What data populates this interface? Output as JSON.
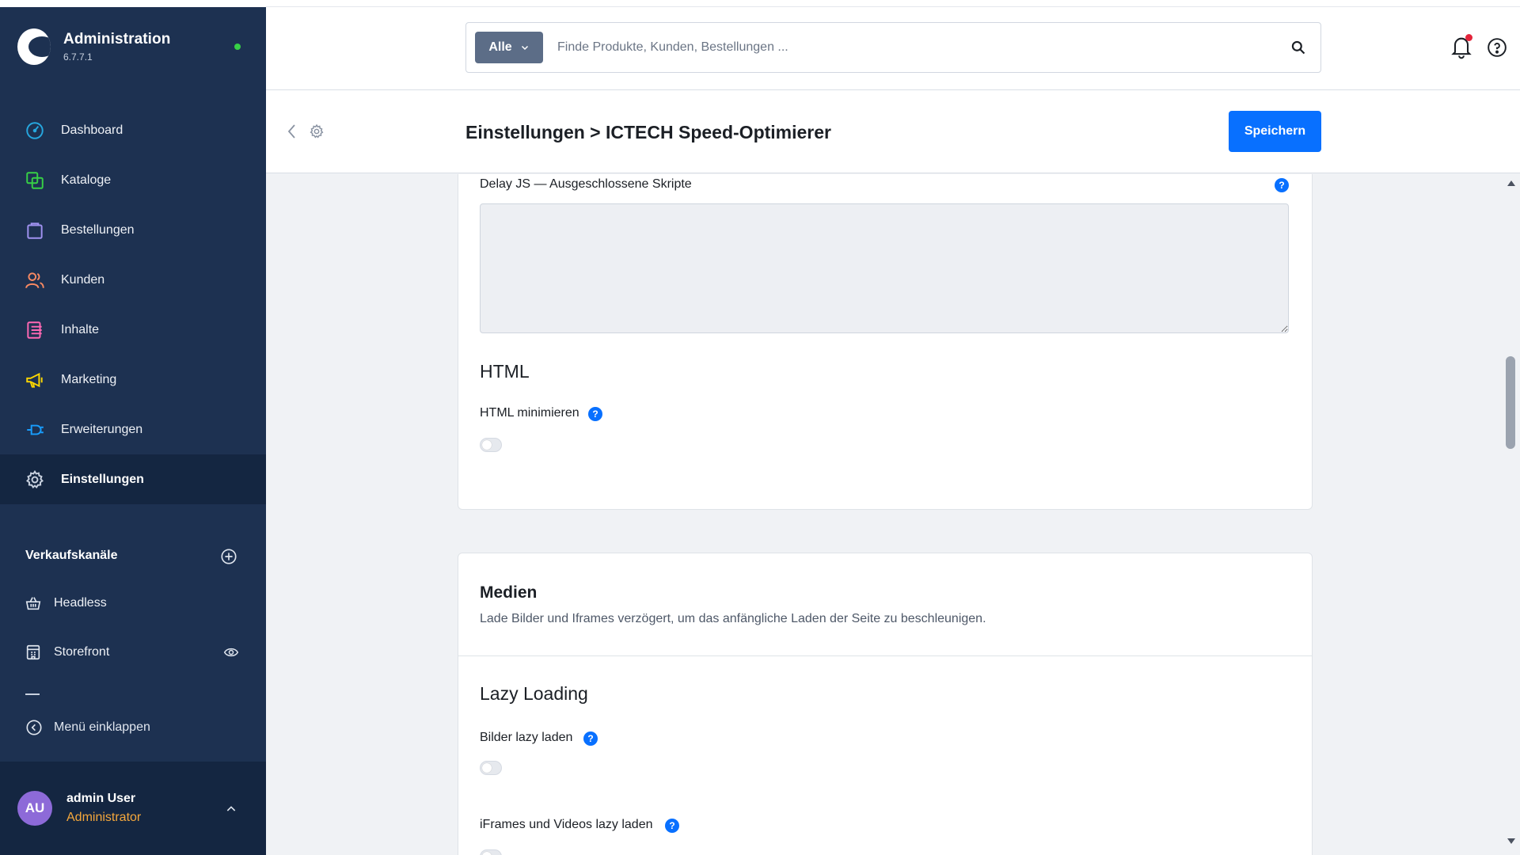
{
  "sidebar": {
    "brand_title": "Administration",
    "brand_version": "6.7.7.1",
    "nav": [
      {
        "label": "Dashboard",
        "icon": "dashboard-gauge-icon",
        "color": "#26a7df"
      },
      {
        "label": "Kataloge",
        "icon": "catalog-icon",
        "color": "#37d046"
      },
      {
        "label": "Bestellungen",
        "icon": "orders-bag-icon",
        "color": "#a092f0"
      },
      {
        "label": "Kunden",
        "icon": "customers-icon",
        "color": "#f88962"
      },
      {
        "label": "Inhalte",
        "icon": "content-icon",
        "color": "#ff68b4"
      },
      {
        "label": "Marketing",
        "icon": "megaphone-icon",
        "color": "#ffd700"
      },
      {
        "label": "Erweiterungen",
        "icon": "plug-icon",
        "color": "#189eff"
      },
      {
        "label": "Einstellungen",
        "icon": "gear-icon",
        "color": "#c8d1df"
      }
    ],
    "sales_channels_title": "Verkaufskanäle",
    "sales_channels": [
      {
        "label": "Headless",
        "icon": "basket-icon"
      },
      {
        "label": "Storefront",
        "icon": "storefront-icon"
      }
    ],
    "collapse_label": "Menü einklappen",
    "user": {
      "initials": "AU",
      "name": "admin User",
      "role": "Administrator"
    }
  },
  "topbar": {
    "search_type": "Alle",
    "search_placeholder": "Finde Produkte, Kunden, Bestellungen ..."
  },
  "smartbar": {
    "title": "Einstellungen > ICTECH Speed-Optimierer",
    "save_label": "Speichern"
  },
  "content": {
    "delay_js_label": "Delay JS — Ausgeschlossene Skripte",
    "html_section_title": "HTML",
    "html_minify_label": "HTML minimieren",
    "media_title": "Medien",
    "media_subtitle": "Lade Bilder und Iframes verzögert, um das anfängliche Laden der Seite zu beschleunigen.",
    "lazy_section_title": "Lazy Loading",
    "lazy_images_label": "Bilder lazy laden",
    "lazy_iframes_label": "iFrames und Videos lazy laden",
    "help_glyph": "?"
  },
  "colors": {
    "sidebar_bg": "#1d3151",
    "sidebar_active": "#142641",
    "primary": "#0870ff",
    "status_online": "#37d046",
    "role_color": "#f4a73c"
  }
}
